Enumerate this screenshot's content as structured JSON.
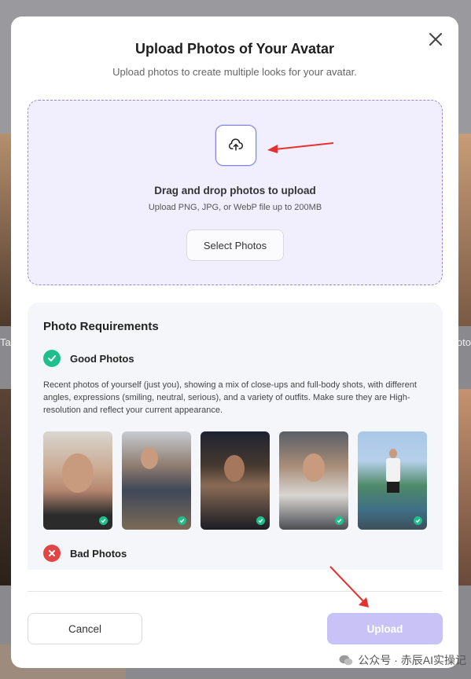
{
  "background": {
    "left_text": "Tal",
    "right_text": "hoto"
  },
  "modal": {
    "title": "Upload Photos of Your Avatar",
    "subtitle": "Upload photos to create multiple looks for your avatar.",
    "close_icon": "close-icon"
  },
  "dropzone": {
    "icon": "cloud-upload-icon",
    "title": "Drag and drop photos to upload",
    "subtitle": "Upload PNG, JPG, or WebP file up to 200MB",
    "button_label": "Select Photos",
    "accent_color": "#9b86d8"
  },
  "requirements": {
    "title": "Photo Requirements",
    "good": {
      "label": "Good Photos",
      "icon": "check-icon",
      "color": "#1fbf8c",
      "description": "Recent photos of yourself (just you), showing a mix of close-ups and full-body shots, with different angles, expressions (smiling, neutral, serious), and a variety of outfits. Make sure they are High-resolution and reflect your current appearance.",
      "examples": [
        "example-photo-1",
        "example-photo-2",
        "example-photo-3",
        "example-photo-4",
        "example-photo-5"
      ]
    },
    "bad": {
      "label": "Bad Photos",
      "icon": "x-icon",
      "color": "#e24545"
    }
  },
  "footer": {
    "cancel_label": "Cancel",
    "upload_label": "Upload",
    "upload_color": "#c8c2f6"
  },
  "watermark": {
    "text": "公众号 · 赤辰AI实操记"
  }
}
